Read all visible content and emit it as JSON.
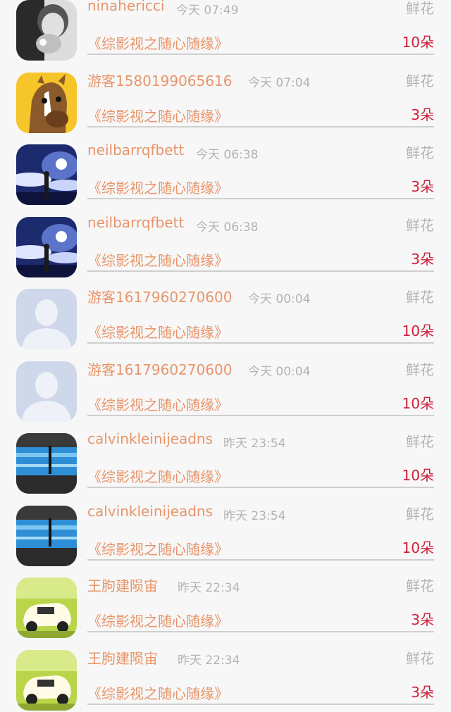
{
  "colors": {
    "accent_orange": "#e8956a",
    "count_red": "#d2203a",
    "meta_gray": "#b3b3b3",
    "background": "#f7f7f7"
  },
  "items": [
    {
      "avatar": "boy-bw-avatar",
      "username": "ninahericci",
      "time": "今天 07:49",
      "gift_type": "鲜花",
      "drama": "《综影视之随心随缘》",
      "count": "10朵"
    },
    {
      "avatar": "horse-cartoon-avatar",
      "username": "游客1580199065616",
      "time": "今天 07:04",
      "gift_type": "鲜花",
      "drama": "《综影视之随心随缘》",
      "count": "3朵"
    },
    {
      "avatar": "night-sky-girl-avatar",
      "username": "neilbarrqfbett",
      "time": "今天 06:38",
      "gift_type": "鲜花",
      "drama": "《综影视之随心随缘》",
      "count": "3朵"
    },
    {
      "avatar": "night-sky-girl-avatar",
      "username": "neilbarrqfbett",
      "time": "今天 06:38",
      "gift_type": "鲜花",
      "drama": "《综影视之随心随缘》",
      "count": "3朵"
    },
    {
      "avatar": "default-person-avatar",
      "username": "游客1617960270600",
      "time": "今天 00:04",
      "gift_type": "鲜花",
      "drama": "《综影视之随心随缘》",
      "count": "10朵"
    },
    {
      "avatar": "default-person-avatar",
      "username": "游客1617960270600",
      "time": "今天 00:04",
      "gift_type": "鲜花",
      "drama": "《综影视之随心随缘》",
      "count": "10朵"
    },
    {
      "avatar": "aquarium-avatar",
      "username": "calvinkleinijeadns",
      "time": "昨天 23:54",
      "gift_type": "鲜花",
      "drama": "《综影视之随心随缘》",
      "count": "10朵"
    },
    {
      "avatar": "aquarium-avatar",
      "username": "calvinkleinijeadns",
      "time": "昨天 23:54",
      "gift_type": "鲜花",
      "drama": "《综影视之随心随缘》",
      "count": "10朵"
    },
    {
      "avatar": "toy-car-avatar",
      "username": "王朐建陨宙",
      "time": "昨天 22:34",
      "gift_type": "鲜花",
      "drama": "《综影视之随心随缘》",
      "count": "3朵"
    },
    {
      "avatar": "toy-car-avatar",
      "username": "王朐建陨宙",
      "time": "昨天 22:34",
      "gift_type": "鲜花",
      "drama": "《综影视之随心随缘》",
      "count": "3朵"
    }
  ]
}
